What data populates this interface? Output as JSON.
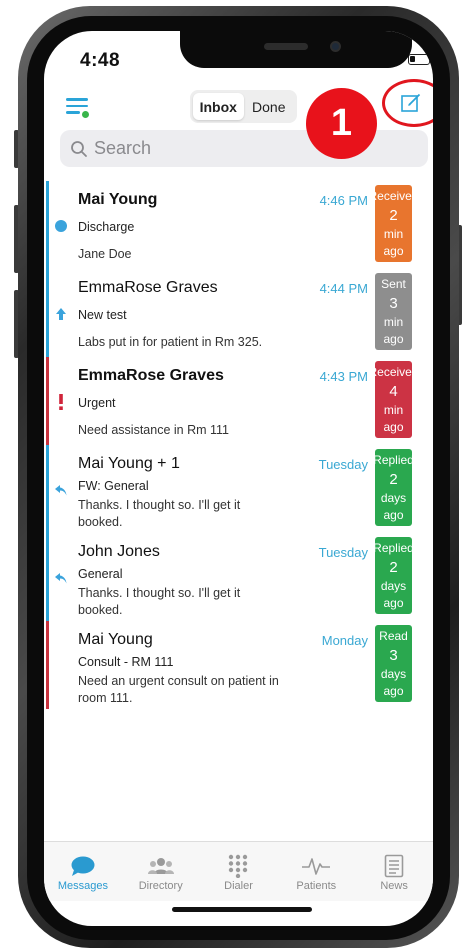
{
  "status_bar": {
    "time": "4:48"
  },
  "header": {
    "segments": [
      {
        "label": "Inbox",
        "active": true
      },
      {
        "label": "Done",
        "active": false
      }
    ],
    "step_badge": "1",
    "icons": {
      "menu": "menu-icon",
      "compose": "compose-icon"
    },
    "accent_color": "#2aa4d8",
    "annotation_color": "#e8121b"
  },
  "search": {
    "placeholder": "Search"
  },
  "messages": [
    {
      "sender": "Mai Young",
      "unread": true,
      "time": "4:46 PM",
      "subject": "Discharge",
      "preview": "Jane Doe",
      "indicator": "unread-dot-icon",
      "bar_color": "#2aa4d8",
      "status": {
        "label": "Received",
        "count": "2",
        "unit": "min ago",
        "color": "#e8752e"
      }
    },
    {
      "sender": "EmmaRose Graves",
      "unread": false,
      "time": "4:44 PM",
      "subject": "New test",
      "preview": "Labs put in for patient in Rm 325.",
      "indicator": "sent-arrow-icon",
      "bar_color": "#2aa4d8",
      "status": {
        "label": "Sent",
        "count": "3",
        "unit": "min ago",
        "color": "#8e8e8e"
      }
    },
    {
      "sender": "EmmaRose Graves",
      "unread": true,
      "time": "4:43 PM",
      "subject": "Urgent",
      "preview": "Need assistance in Rm 111",
      "indicator": "urgent-exclamation-icon",
      "bar_color": "#c8333e",
      "status": {
        "label": "Received",
        "count": "4",
        "unit": "min ago",
        "color": "#cc3344"
      }
    },
    {
      "sender": "Mai Young + 1",
      "unread": false,
      "time": "Tuesday",
      "subject": "FW: General",
      "preview": "Thanks. I thought so. I'll get it booked.",
      "indicator": "reply-arrow-icon",
      "bar_color": "#2aa4d8",
      "status": {
        "label": "Replied",
        "count": "2",
        "unit": "days ago",
        "color": "#2aa84f"
      }
    },
    {
      "sender": "John Jones",
      "unread": false,
      "time": "Tuesday",
      "subject": "General",
      "preview": "Thanks. I thought so. I'll get it booked.",
      "indicator": "reply-arrow-icon",
      "bar_color": "#2aa4d8",
      "status": {
        "label": "Replied",
        "count": "2",
        "unit": "days ago",
        "color": "#2aa84f"
      }
    },
    {
      "sender": "Mai Young",
      "unread": false,
      "time": "Monday",
      "subject": "Consult - RM 111",
      "preview": "Need an urgent consult on patient in room 111.",
      "indicator": "none",
      "bar_color": "#c8333e",
      "status": {
        "label": "Read",
        "count": "3",
        "unit": "days ago",
        "color": "#2aa84f"
      }
    }
  ],
  "tabs": [
    {
      "label": "Messages",
      "icon": "chat-bubble-icon",
      "active": true
    },
    {
      "label": "Directory",
      "icon": "people-icon",
      "active": false
    },
    {
      "label": "Dialer",
      "icon": "keypad-icon",
      "active": false
    },
    {
      "label": "Patients",
      "icon": "heartbeat-icon",
      "active": false
    },
    {
      "label": "News",
      "icon": "newspaper-icon",
      "active": false
    }
  ]
}
